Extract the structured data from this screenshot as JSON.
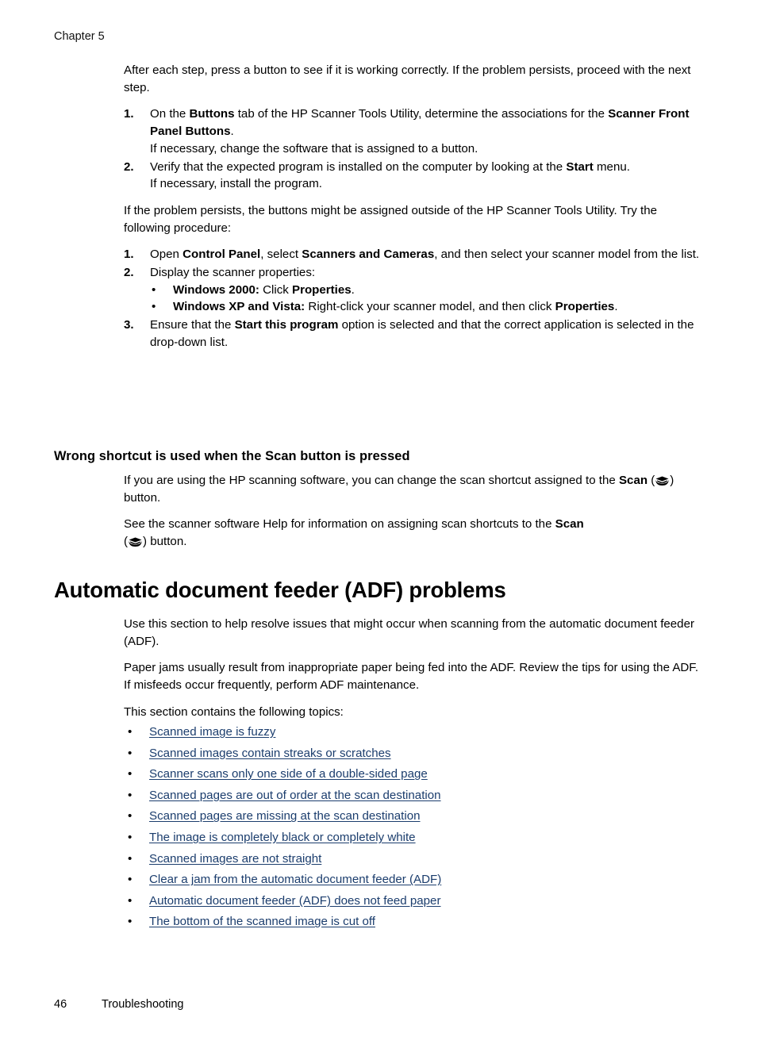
{
  "page": {
    "running_head": "Chapter 5",
    "footer_page_number": "46",
    "footer_section": "Troubleshooting",
    "link_color": "#1b3d6d"
  },
  "intro": {
    "paragraph": "After each step, press a button to see if it is working correctly. If the problem persists, proceed with the next step."
  },
  "list_one": {
    "items": [
      {
        "marker": "1.",
        "line_prefix": "On the ",
        "bold_1": "Buttons",
        "line_mid": " tab of the HP Scanner Tools Utility, determine the associations for the ",
        "bold_2": "Scanner Front Panel Buttons",
        "line_suffix": ".",
        "follow_up": "If necessary, change the software that is assigned to a button."
      },
      {
        "marker": "2.",
        "line_prefix": "Verify that the expected program is installed on the computer by looking at the ",
        "bold_1": "Start",
        "line_mid": " menu.",
        "bold_2": "",
        "line_suffix": "",
        "follow_up": "If necessary, install the program."
      }
    ]
  },
  "bridge": {
    "paragraph": "If the problem persists, the buttons might be assigned outside of the HP Scanner Tools Utility. Try the following procedure:"
  },
  "list_two": {
    "item1": {
      "marker": "1.",
      "prefix": "Open ",
      "bold_1": "Control Panel",
      "mid": ", select ",
      "bold_2": "Scanners and Cameras",
      "suffix": ", and then select your scanner model from the list."
    },
    "item2": {
      "marker": "2.",
      "text": "Display the scanner properties:",
      "bullets": [
        {
          "dot": "•",
          "bold": "Windows 2000:",
          "rest_prefix": " Click ",
          "bold_2": "Properties",
          "rest_suffix": "."
        },
        {
          "dot": "•",
          "bold": "Windows XP and Vista:",
          "rest_prefix": " Right-click your scanner model, and then click ",
          "bold_2": "Properties",
          "rest_suffix": "."
        }
      ]
    },
    "item3": {
      "marker": "3.",
      "prefix": "Ensure that the ",
      "bold_1": "Start this program",
      "suffix": " option is selected and that the correct application is selected in the drop-down list."
    }
  },
  "wrong_shortcut": {
    "heading": "Wrong shortcut is used when the Scan button is pressed",
    "para1_prefix": "If you are using the HP scanning software, you can change the scan shortcut assigned to the ",
    "para1_bold": "Scan",
    "para1_open_paren": " (",
    "para1_close_paren": ") button.",
    "para2_prefix": "See the scanner software Help for information on assigning scan shortcuts to the ",
    "para2_bold": "Scan",
    "para2_open_paren": "(",
    "para2_close_paren": ") button.",
    "icon_name": "scan-button-icon"
  },
  "adf_section": {
    "title": "Automatic document feeder (ADF) problems",
    "para1": "Use this section to help resolve issues that might occur when scanning from the automatic document feeder (ADF).",
    "para2": "Paper jams usually result from inappropriate paper being fed into the ADF. Review the tips for using the ADF. If misfeeds occur frequently, perform ADF maintenance.",
    "para3": "This section contains the following topics:",
    "bullet_char": "•",
    "topics": [
      "Scanned image is fuzzy",
      "Scanned images contain streaks or scratches",
      "Scanner scans only one side of a double-sided page",
      "Scanned pages are out of order at the scan destination",
      "Scanned pages are missing at the scan destination",
      "The image is completely black or completely white",
      "Scanned images are not straight",
      "Clear a jam from the automatic document feeder (ADF)",
      "Automatic document feeder (ADF) does not feed paper",
      "The bottom of the scanned image is cut off"
    ]
  }
}
